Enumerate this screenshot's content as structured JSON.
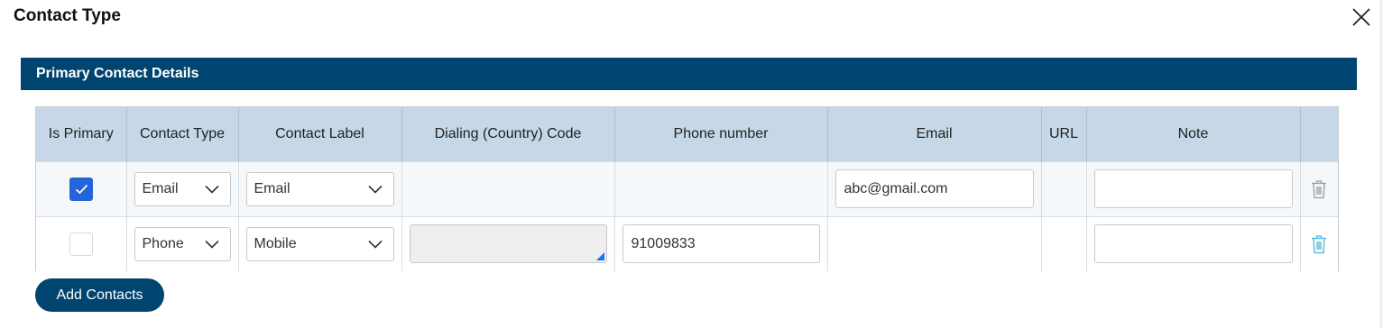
{
  "dialog": {
    "title": "Contact Type",
    "close_icon": "close-icon"
  },
  "section": {
    "title": "Primary Contact Details"
  },
  "table": {
    "headers": [
      "Is Primary",
      "Contact Type",
      "Contact Label",
      "Dialing (Country) Code",
      "Phone number",
      "Email",
      "URL",
      "Note",
      ""
    ],
    "rows": [
      {
        "is_primary": true,
        "contact_type": "Email",
        "contact_label": "Email",
        "dialing_code": "",
        "phone_number": "",
        "email": "abc@gmail.com",
        "url": "",
        "note": "",
        "delete_icon": "trash-icon",
        "delete_icon_color": "#9a9a9a"
      },
      {
        "is_primary": false,
        "contact_type": "Phone",
        "contact_label": "Mobile",
        "dialing_code": "",
        "phone_number": "91009833",
        "email": "",
        "url": "",
        "note": "",
        "delete_icon": "trash-icon",
        "delete_icon_color": "#49b6d6"
      }
    ]
  },
  "actions": {
    "add_contacts_label": "Add Contacts"
  },
  "colors": {
    "primary_navy": "#004570",
    "header_blue": "#c6d8e7",
    "checkbox_blue": "#2563d8"
  }
}
